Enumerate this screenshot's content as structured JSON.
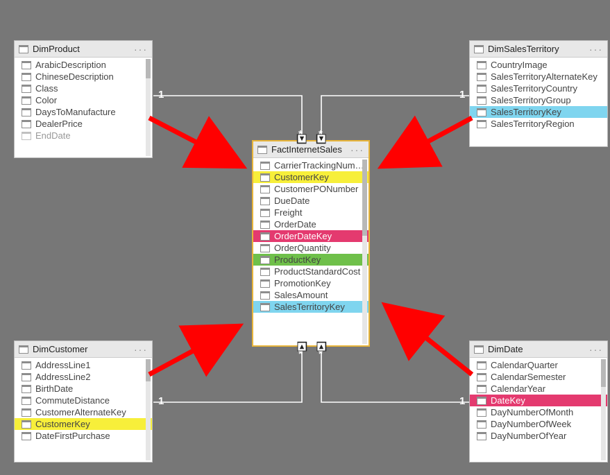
{
  "tables": {
    "dimProduct": {
      "title": "DimProduct",
      "fields": [
        "ArabicDescription",
        "ChineseDescription",
        "Class",
        "Color",
        "DaysToManufacture",
        "DealerPrice",
        "EndDate"
      ]
    },
    "dimSalesTerritory": {
      "title": "DimSalesTerritory",
      "fields": [
        "CountryImage",
        "SalesTerritoryAlternateKey",
        "SalesTerritoryCountry",
        "SalesTerritoryGroup",
        "SalesTerritoryKey",
        "SalesTerritoryRegion"
      ]
    },
    "dimCustomer": {
      "title": "DimCustomer",
      "fields": [
        "AddressLine1",
        "AddressLine2",
        "BirthDate",
        "CommuteDistance",
        "CustomerAlternateKey",
        "CustomerKey",
        "DateFirstPurchase"
      ]
    },
    "dimDate": {
      "title": "DimDate",
      "fields": [
        "CalendarQuarter",
        "CalendarSemester",
        "CalendarYear",
        "DateKey",
        "DayNumberOfMonth",
        "DayNumberOfWeek",
        "DayNumberOfYear"
      ]
    },
    "factInternetSales": {
      "title": "FactInternetSales",
      "fields": [
        "CarrierTrackingNumber",
        "CustomerKey",
        "CustomerPONumber",
        "DueDate",
        "Freight",
        "OrderDate",
        "OrderDateKey",
        "OrderQuantity",
        "ProductKey",
        "ProductStandardCost",
        "PromotionKey",
        "SalesAmount",
        "SalesTerritoryKey"
      ]
    }
  },
  "highlights": {
    "dimSalesTerritory.SalesTerritoryKey": "cyan",
    "dimCustomer.CustomerKey": "yellow",
    "dimDate.DateKey": "pink",
    "factInternetSales.CustomerKey": "yellow",
    "factInternetSales.OrderDateKey": "pink",
    "factInternetSales.ProductKey": "green",
    "factInternetSales.SalesTerritoryKey": "cyan"
  },
  "cardinality": {
    "one": "1",
    "many": "*"
  },
  "menu": "···"
}
